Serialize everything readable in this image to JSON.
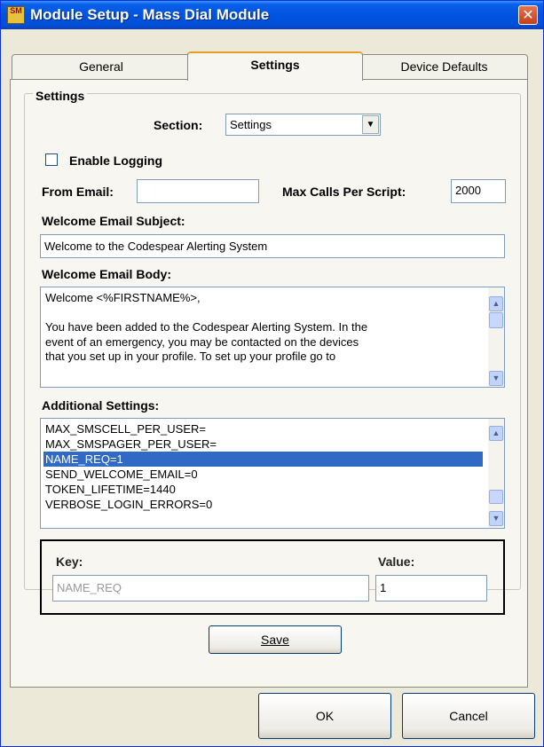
{
  "window": {
    "title": "Module Setup - Mass Dial Module",
    "app_icon_text": "SM"
  },
  "tabs": [
    {
      "label": "General"
    },
    {
      "label": "Settings"
    },
    {
      "label": "Device Defaults"
    }
  ],
  "group": {
    "title": "Settings"
  },
  "section": {
    "label": "Section:",
    "value": "Settings"
  },
  "enable_logging": {
    "label": "Enable Logging",
    "checked": false
  },
  "from_email": {
    "label": "From Email:",
    "value": ""
  },
  "max_calls": {
    "label": "Max Calls Per Script:",
    "value": "2000"
  },
  "welcome_subject": {
    "label": "Welcome Email Subject:",
    "value": "Welcome to the Codespear Alerting System"
  },
  "welcome_body": {
    "label": "Welcome Email Body:",
    "lines": [
      "Welcome <%FIRSTNAME%>,",
      "",
      "You have been added to the Codespear Alerting System.  In the",
      "event of an emergency, you may be contacted on the devices",
      "that you set up in your profile.  To set up your profile go to"
    ]
  },
  "additional_settings": {
    "label": "Additional Settings:",
    "items": [
      "MAX_SMSCELL_PER_USER=",
      "MAX_SMSPAGER_PER_USER=",
      "NAME_REQ=1",
      "SEND_WELCOME_EMAIL=0",
      "TOKEN_LIFETIME=1440",
      "VERBOSE_LOGIN_ERRORS=0"
    ],
    "selected": "NAME_REQ=1"
  },
  "key_value": {
    "key_label": "Key:",
    "key_value": "NAME_REQ",
    "value_label": "Value:",
    "value_value": "1"
  },
  "buttons": {
    "save": "Save",
    "ok": "OK",
    "cancel": "Cancel"
  },
  "icons": {
    "close": "close-icon",
    "dropdown": "chevron-down-icon",
    "scroll_up": "arrow-up-icon",
    "scroll_down": "arrow-down-icon"
  },
  "colors": {
    "titlebar": "#0053e0",
    "selection": "#316ac5",
    "window_bg": "#ece9d8",
    "close_button": "#c4401c"
  }
}
